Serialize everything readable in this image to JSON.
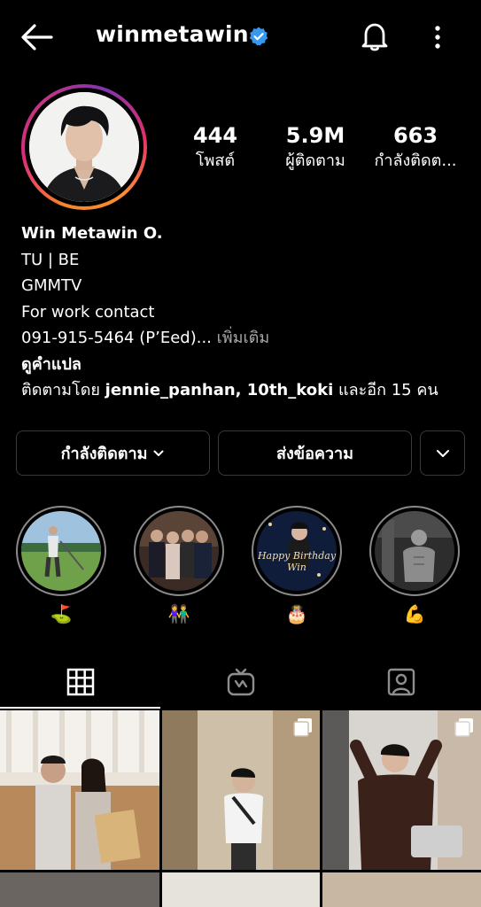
{
  "header": {
    "username": "winmetawin"
  },
  "stats": [
    {
      "value": "444",
      "label": "โพสต์"
    },
    {
      "value": "5.9M",
      "label": "ผู้ติดตาม"
    },
    {
      "value": "663",
      "label": "กำลังติดต..."
    }
  ],
  "bio": {
    "name": "Win Metawin O.",
    "line1": "TU | BE",
    "line2": "GMMTV",
    "line3": "For work contact",
    "phone": "091-915-5464 (P’Eed)...",
    "more": "เพิ่มเติม",
    "translate": "ดูคำแปล",
    "followed_prefix": "ติดตามโดย ",
    "followed_users": "jennie_panhan, 10th_koki",
    "followed_suffix": " และอีก 15 คน"
  },
  "actions": {
    "following": "กำลังติดตาม",
    "message": "ส่งข้อความ"
  },
  "highlights": [
    {
      "label": "⛳",
      "icon": "golf-flag-emoji"
    },
    {
      "label": "👫",
      "icon": "couple-emoji"
    },
    {
      "label": "🎂",
      "icon": "birthday-cake-emoji"
    },
    {
      "label": "💪",
      "icon": "flexed-biceps-emoji"
    }
  ],
  "highlight_birthday_text": "Happy Birthday Win",
  "tabs": [
    "grid-icon",
    "igtv-icon",
    "tagged-icon"
  ],
  "colors": {
    "background": "#000000",
    "verified": "#3897f0",
    "muted": "#a8a8a8"
  }
}
